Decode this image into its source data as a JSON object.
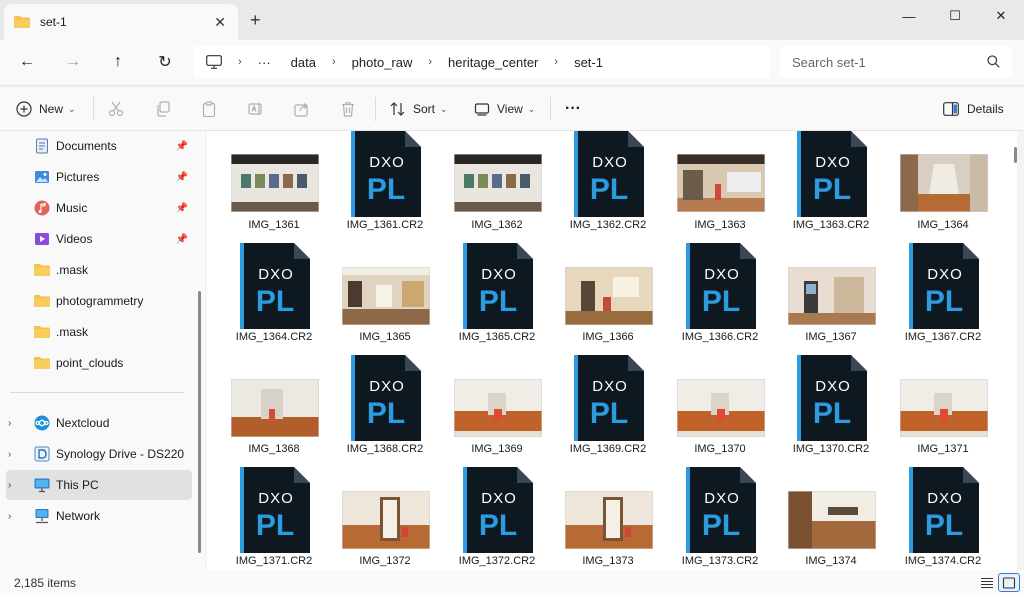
{
  "tab": {
    "title": "set-1",
    "close": "✕",
    "new_tab": "+"
  },
  "window": {
    "minimize": "—",
    "maximize": "☐",
    "close": "✕"
  },
  "nav": {
    "back": "←",
    "forward": "→",
    "up": "↑",
    "refresh": "↻",
    "more_crumbs": "···",
    "breadcrumbs": [
      "data",
      "photo_raw",
      "heritage_center",
      "set-1"
    ],
    "separator": "›"
  },
  "search": {
    "placeholder": "Search set-1"
  },
  "commands": {
    "new": "New",
    "sort": "Sort",
    "view": "View",
    "more": "···",
    "details": "Details"
  },
  "sidebar": {
    "quick_access": [
      {
        "label": "Documents",
        "icon": "documents-icon",
        "pinned": true
      },
      {
        "label": "Pictures",
        "icon": "pictures-icon",
        "pinned": true
      },
      {
        "label": "Music",
        "icon": "music-icon",
        "pinned": true
      },
      {
        "label": "Videos",
        "icon": "videos-icon",
        "pinned": true
      },
      {
        "label": ".mask",
        "icon": "folder-icon",
        "pinned": false
      },
      {
        "label": "photogrammetry",
        "icon": "folder-icon",
        "pinned": false
      },
      {
        "label": ".mask",
        "icon": "folder-icon",
        "pinned": false
      },
      {
        "label": "point_clouds",
        "icon": "folder-icon",
        "pinned": false
      }
    ],
    "locations": [
      {
        "label": "Nextcloud",
        "icon": "nextcloud-icon"
      },
      {
        "label": "Synology Drive - DS220",
        "icon": "synology-drive-icon"
      },
      {
        "label": "This PC",
        "icon": "this-pc-icon",
        "selected": true
      },
      {
        "label": "Network",
        "icon": "network-icon"
      }
    ]
  },
  "raw_icon": {
    "brand_top": "DXO",
    "brand_main": "PL"
  },
  "files": [
    {
      "name": "IMG_1361",
      "kind": "photo",
      "scene": "gallery-wall"
    },
    {
      "name": "IMG_1361.CR2",
      "kind": "raw"
    },
    {
      "name": "IMG_1362",
      "kind": "photo",
      "scene": "gallery-wall"
    },
    {
      "name": "IMG_1362.CR2",
      "kind": "raw"
    },
    {
      "name": "IMG_1363",
      "kind": "photo",
      "scene": "exhibit-room"
    },
    {
      "name": "IMG_1363.CR2",
      "kind": "raw"
    },
    {
      "name": "IMG_1364",
      "kind": "photo",
      "scene": "corridor"
    },
    {
      "name": "IMG_1364.CR2",
      "kind": "raw"
    },
    {
      "name": "IMG_1365",
      "kind": "photo",
      "scene": "room-wide"
    },
    {
      "name": "IMG_1365.CR2",
      "kind": "raw"
    },
    {
      "name": "IMG_1366",
      "kind": "photo",
      "scene": "room-corner"
    },
    {
      "name": "IMG_1366.CR2",
      "kind": "raw"
    },
    {
      "name": "IMG_1367",
      "kind": "photo",
      "scene": "kiosk"
    },
    {
      "name": "IMG_1367.CR2",
      "kind": "raw"
    },
    {
      "name": "IMG_1368",
      "kind": "photo",
      "scene": "hall-white"
    },
    {
      "name": "IMG_1368.CR2",
      "kind": "raw"
    },
    {
      "name": "IMG_1369",
      "kind": "photo",
      "scene": "orange-room"
    },
    {
      "name": "IMG_1369.CR2",
      "kind": "raw"
    },
    {
      "name": "IMG_1370",
      "kind": "photo",
      "scene": "orange-room"
    },
    {
      "name": "IMG_1370.CR2",
      "kind": "raw"
    },
    {
      "name": "IMG_1371",
      "kind": "photo",
      "scene": "orange-room"
    },
    {
      "name": "IMG_1371.CR2",
      "kind": "raw"
    },
    {
      "name": "IMG_1372",
      "kind": "photo",
      "scene": "door-room"
    },
    {
      "name": "IMG_1372.CR2",
      "kind": "raw"
    },
    {
      "name": "IMG_1373",
      "kind": "photo",
      "scene": "door-room"
    },
    {
      "name": "IMG_1373.CR2",
      "kind": "raw"
    },
    {
      "name": "IMG_1374",
      "kind": "photo",
      "scene": "wood-wall"
    },
    {
      "name": "IMG_1374.CR2",
      "kind": "raw"
    }
  ],
  "status": {
    "item_count": "2,185 items"
  },
  "colors": {
    "accent": "#3b7bd4",
    "folder": "#f4c04e",
    "raw_bg": "#0d1821",
    "raw_stripe": "#2c9be0"
  }
}
